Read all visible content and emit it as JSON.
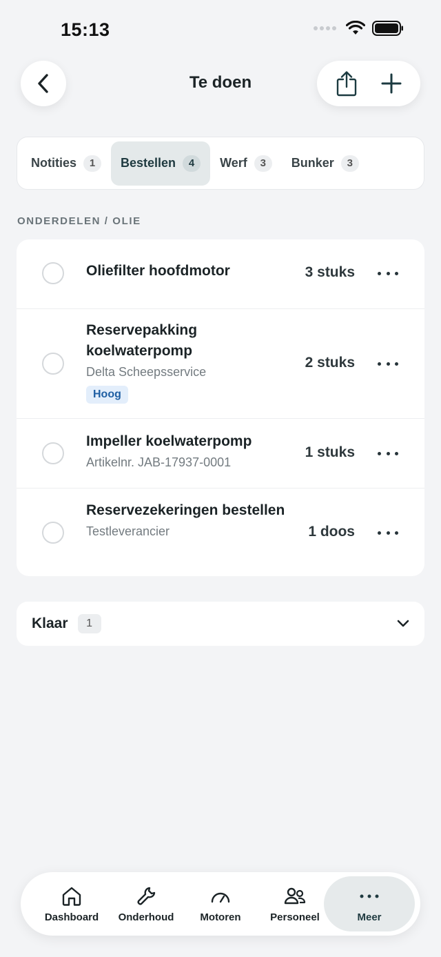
{
  "status_bar": {
    "time": "15:13"
  },
  "header": {
    "title": "Te doen"
  },
  "tabs": [
    {
      "label": "Notities",
      "count": "1",
      "active": false
    },
    {
      "label": "Bestellen",
      "count": "4",
      "active": true
    },
    {
      "label": "Werf",
      "count": "3",
      "active": false
    },
    {
      "label": "Bunker",
      "count": "3",
      "active": false
    }
  ],
  "section": {
    "label": "ONDERDELEN / OLIE"
  },
  "items": [
    {
      "title": "Oliefilter hoofdmotor",
      "subtitle": "",
      "badge": "",
      "quantity": "3 stuks"
    },
    {
      "title": "Reservepakking koelwaterpomp",
      "subtitle": "Delta Scheepsservice",
      "badge": "Hoog",
      "quantity": "2 stuks"
    },
    {
      "title": "Impeller koelwaterpomp",
      "subtitle": "Artikelnr. JAB-17937-0001",
      "badge": "",
      "quantity": "1 stuks"
    },
    {
      "title": "Reservezekeringen bestellen",
      "subtitle": "Testleverancier",
      "badge": "",
      "quantity": "1 doos"
    }
  ],
  "done": {
    "label": "Klaar",
    "count": "1"
  },
  "nav": [
    {
      "label": "Dashboard",
      "icon": "home-icon"
    },
    {
      "label": "Onderhoud",
      "icon": "wrench-icon"
    },
    {
      "label": "Motoren",
      "icon": "gauge-icon"
    },
    {
      "label": "Personeel",
      "icon": "people-icon"
    },
    {
      "label": "Meer",
      "icon": "more-icon",
      "active": true
    }
  ],
  "colors": {
    "background": "#f3f4f6",
    "active_tab": "#e4e9ea",
    "badge_bg": "#e3eefb",
    "badge_text": "#1f5fa3"
  }
}
